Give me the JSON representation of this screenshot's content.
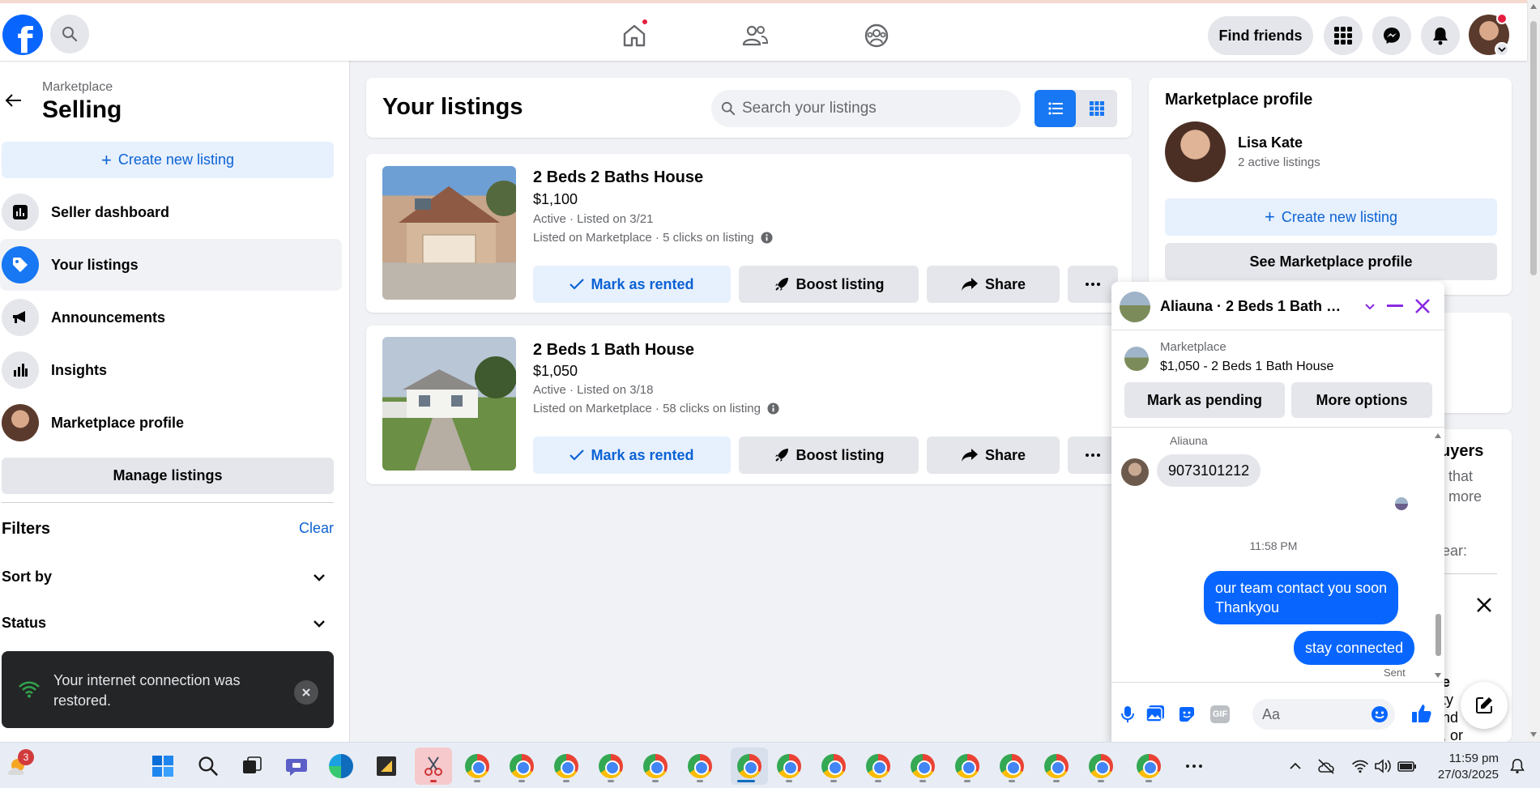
{
  "topbar": {
    "find_friends": "Find friends"
  },
  "sidebar": {
    "crumb": "Marketplace",
    "title": "Selling",
    "create_label": "Create new listing",
    "items": [
      {
        "label": "Seller dashboard",
        "icon": "dashboard-icon"
      },
      {
        "label": "Your listings",
        "icon": "tag-icon"
      },
      {
        "label": "Announcements",
        "icon": "megaphone-icon"
      },
      {
        "label": "Insights",
        "icon": "bar-chart-icon"
      },
      {
        "label": "Marketplace profile",
        "icon": "avatar"
      }
    ],
    "manage_label": "Manage listings",
    "filters_label": "Filters",
    "clear_label": "Clear",
    "sort_label": "Sort by",
    "status_label": "Status",
    "toast_text": "Your internet connection was restored."
  },
  "listings": {
    "title": "Your listings",
    "search_placeholder": "Search your listings",
    "items": [
      {
        "title": "2 Beds 2 Baths House",
        "price": "$1,100",
        "status": "Active · Listed on 3/21",
        "meta": "Listed on Marketplace · 5 clicks on listing"
      },
      {
        "title": "2 Beds 1 Bath House",
        "price": "$1,050",
        "status": "Active · Listed on 3/18",
        "meta": "Listed on Marketplace · 58 clicks on listing"
      }
    ],
    "mark_rented": "Mark as rented",
    "boost": "Boost listing",
    "share": "Share"
  },
  "profile": {
    "title": "Marketplace profile",
    "name": "Lisa Kate",
    "sub": "2 active listings",
    "create_label": "Create new listing",
    "see_label": "See Marketplace profile",
    "partial_heading": "uyers",
    "partial_line1": "that",
    "partial_line2": "more",
    "partial_line3": "ear:",
    "partial_bottom1": "e",
    "partial_bottom2": "ty",
    "partial_bottom3": "nd",
    "partial_bottom4": ", or"
  },
  "chat": {
    "title": "Aliauna · 2 Beds 1 Bath Ho...",
    "sub_label": "Marketplace",
    "sub_item": "$1,050 - 2 Beds 1 Bath House",
    "mark_pending": "Mark as pending",
    "more_options": "More options",
    "sender": "Aliauna",
    "incoming": "9073101212",
    "time": "11:58 PM",
    "out1_line1": "our team contact you soon",
    "out1_line2": "Thankyou",
    "out2": "stay connected",
    "sent": "Sent",
    "composer_placeholder": "Aa",
    "gif": "GIF"
  },
  "taskbar": {
    "weather_badge": "3",
    "time": "11:59 pm",
    "date": "27/03/2025"
  }
}
